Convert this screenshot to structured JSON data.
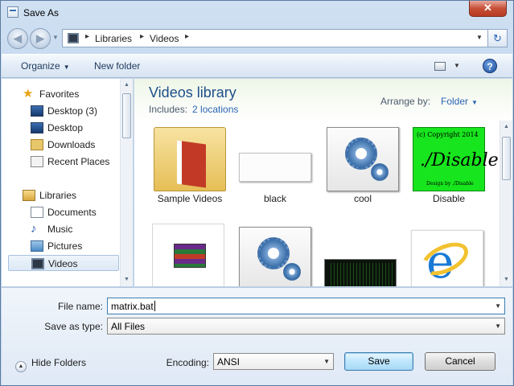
{
  "window": {
    "title": "Save As",
    "close_label": "✕"
  },
  "address": {
    "crumbs": [
      "Libraries",
      "Videos"
    ],
    "separator": "▸",
    "refresh_glyph": "↻"
  },
  "toolbar": {
    "organize_label": "Organize",
    "new_folder_label": "New folder",
    "help_glyph": "?"
  },
  "nav": {
    "favorites_label": "Favorites",
    "favorites": [
      {
        "label": "Desktop (3)",
        "icon": "monitor-icon"
      },
      {
        "label": "Desktop",
        "icon": "monitor-icon"
      },
      {
        "label": "Downloads",
        "icon": "downloads-folder-icon"
      },
      {
        "label": "Recent Places",
        "icon": "recent-places-icon"
      }
    ],
    "libraries_label": "Libraries",
    "libraries": [
      {
        "label": "Documents",
        "icon": "documents-icon"
      },
      {
        "label": "Music",
        "icon": "music-note-icon"
      },
      {
        "label": "Pictures",
        "icon": "pictures-icon"
      },
      {
        "label": "Videos",
        "icon": "video-film-icon",
        "selected": true
      }
    ]
  },
  "library": {
    "title": "Videos library",
    "includes_label": "Includes:",
    "includes_link": "2 locations",
    "arrange_label": "Arrange by:",
    "arrange_value": "Folder"
  },
  "items": [
    {
      "label": "Sample Videos",
      "icon": "folder-icon"
    },
    {
      "label": "black",
      "icon": "blank-image-icon"
    },
    {
      "label": "cool",
      "icon": "gears-icon"
    },
    {
      "label": "Disable",
      "icon": "disable-thumbnail"
    },
    {
      "label": "",
      "icon": "winrar-archive-icon"
    },
    {
      "label": "",
      "icon": "gears-icon"
    },
    {
      "label": "",
      "icon": "matrix-video-thumbnail"
    },
    {
      "label": "",
      "icon": "internet-explorer-icon"
    }
  ],
  "disable_thumb": {
    "line1": "(c) Copyright 2014",
    "line2": "./Disable",
    "line3": "Design by ./Disable"
  },
  "form": {
    "filename_label": "File name:",
    "filename_value": "matrix.bat",
    "savetype_label": "Save as type:",
    "savetype_value": "All Files",
    "encoding_label": "Encoding:",
    "encoding_value": "ANSI"
  },
  "buttons": {
    "hide_folders_label": "Hide Folders",
    "save_label": "Save",
    "cancel_label": "Cancel"
  },
  "colors": {
    "library_title": "#1e4f8a",
    "link": "#2a64b4",
    "close_button": "#c74f37",
    "disable_green": "#17e51d"
  }
}
